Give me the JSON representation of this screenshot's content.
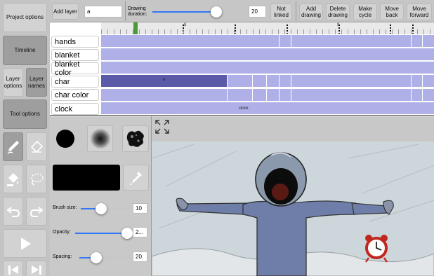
{
  "sidebar": {
    "project_options": "Project options",
    "timeline": "Timeline",
    "layer_options": "Layer options",
    "layer_names": "Layer names",
    "tool_options": "Tool options"
  },
  "toolbar": {
    "add_layer": "Add layer",
    "layer_name_value": "a",
    "drawing_duration_label": "Drawing duration:",
    "drawing_duration_value": "20",
    "drawing_duration_level": 0.7,
    "not_linked": "Not linked",
    "add_drawing": "Add drawing",
    "delete_drawing": "Delete drawing",
    "make_cycle": "Make cycle",
    "move_back": "Move back",
    "move_forward": "Move forward"
  },
  "timeline": {
    "ruler_numbers": [
      "8",
      "9"
    ],
    "layers": [
      {
        "name": "hands"
      },
      {
        "name": "blanket"
      },
      {
        "name": "blanket color"
      },
      {
        "name": "char",
        "cell_label": "a"
      },
      {
        "name": "char color"
      },
      {
        "name": "clock",
        "cell_label": "clock"
      }
    ]
  },
  "tool_options": {
    "brush_size_label": "Brush size:",
    "brush_size_value": "10",
    "brush_size_level": 0.42,
    "opacity_label": "Opacity:",
    "opacity_value": "2...",
    "opacity_level": 0.95,
    "spacing_label": "Spacing:",
    "spacing_value": "20",
    "spacing_level": 0.33,
    "brush_color": "#000000"
  },
  "colors": {
    "layer_bar": "#b0b0e8",
    "selected_cell": "#5a5aa8",
    "slider_accent": "#3478f6",
    "playhead": "#4a9a3a"
  },
  "icons": [
    "pen-icon",
    "eraser-icon",
    "paint-bucket-icon",
    "lasso-icon",
    "undo-icon",
    "redo-icon",
    "play-icon",
    "expand-icon",
    "eyedropper-icon"
  ]
}
